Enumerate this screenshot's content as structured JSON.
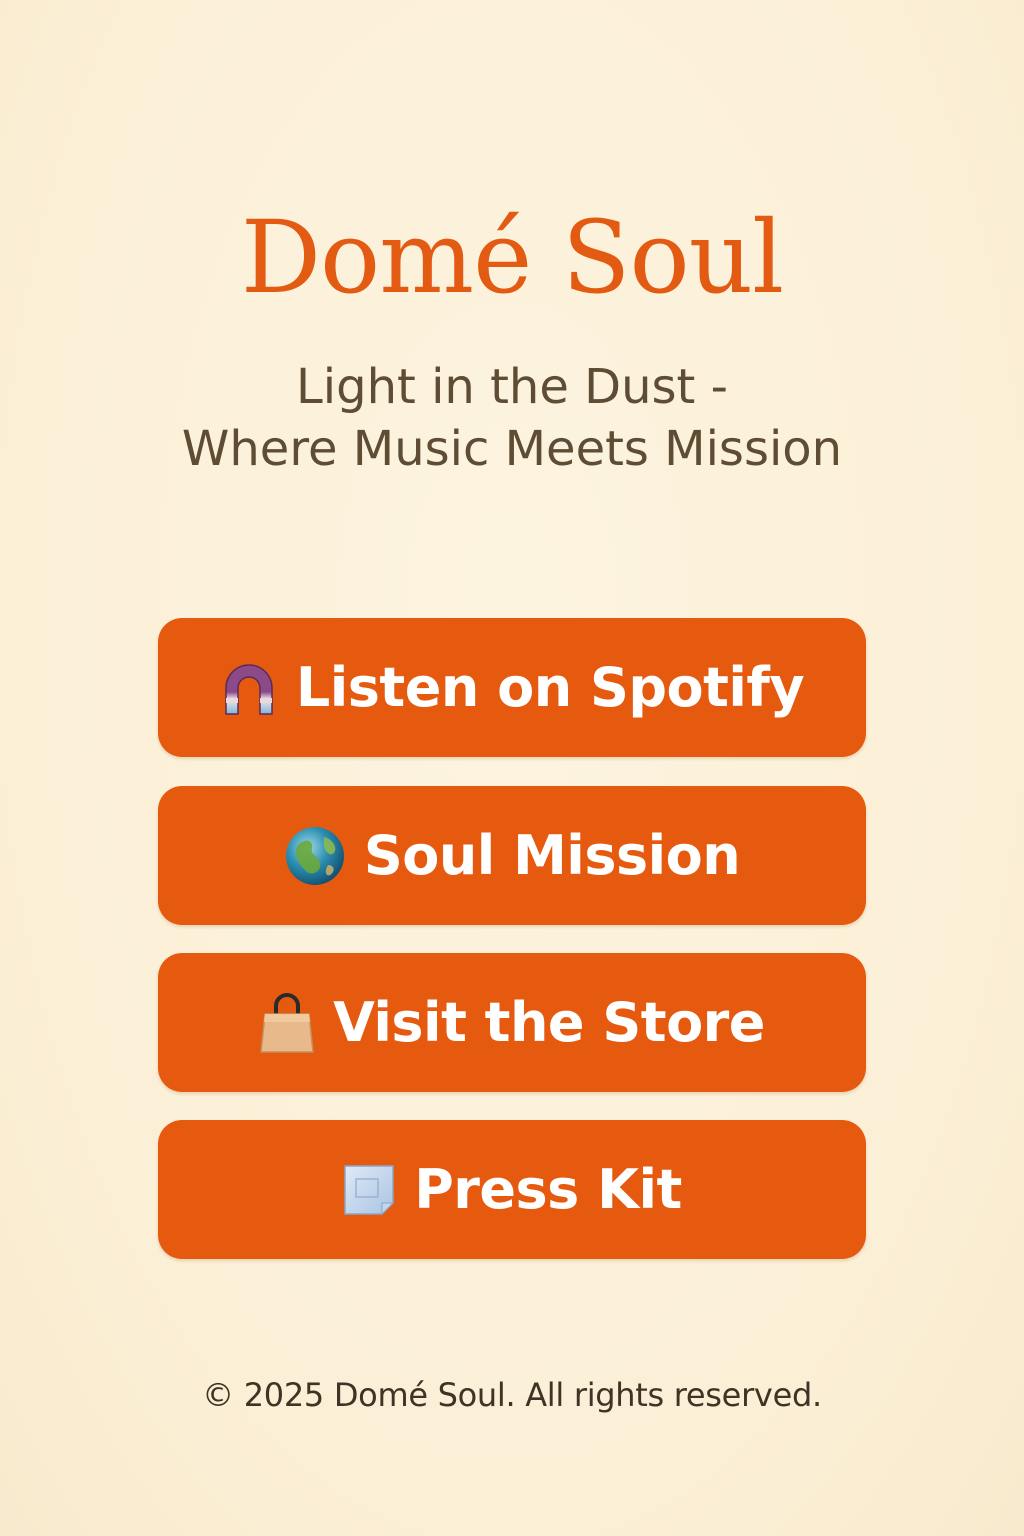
{
  "brand": {
    "title": "Domé Soul",
    "subtitle_line1": "Light in the Dust -",
    "subtitle_line2": "Where Music Meets Mission"
  },
  "links": [
    {
      "label": "Listen on Spotify",
      "icon": "headphones-icon"
    },
    {
      "label": "Soul Mission",
      "icon": "globe-icon"
    },
    {
      "label": "Visit the Store",
      "icon": "shopping-bag-icon"
    },
    {
      "label": "Press Kit",
      "icon": "document-icon"
    }
  ],
  "footer": {
    "text": "© 2025 Domé Soul. All rights reserved."
  },
  "colors": {
    "background": "#fcf2dc",
    "accent": "#e65a10",
    "title": "#e35b12",
    "subtitle": "#5e4d34",
    "button_text": "#ffffff"
  }
}
